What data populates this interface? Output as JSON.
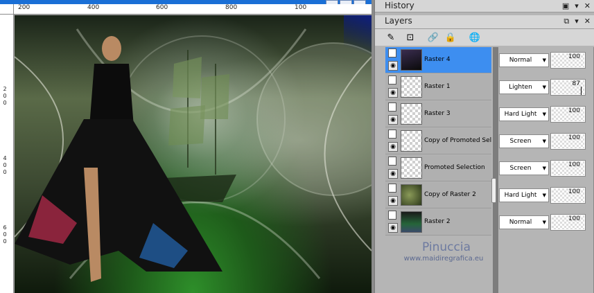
{
  "rulers": {
    "horizontal": [
      "200",
      "400",
      "600",
      "800",
      "100"
    ],
    "vertical": [
      [
        "2",
        "0",
        "0"
      ],
      [
        "4",
        "0",
        "0"
      ],
      [
        "6",
        "0",
        "0"
      ]
    ]
  },
  "panels": {
    "history": {
      "title": "History"
    },
    "layers": {
      "title": "Layers"
    }
  },
  "icons": {
    "history_controls": [
      "▣",
      "▾",
      "✕"
    ],
    "layers_controls": [
      "⧉",
      "▾",
      "✕"
    ],
    "toolbar": [
      "✎",
      "⊡",
      "🔗",
      "🔒",
      "🌐"
    ]
  },
  "layers": [
    {
      "name": "Raster 4",
      "blend": "Normal",
      "opacity": "100",
      "selected": true,
      "thumb": "dark"
    },
    {
      "name": "Raster 1",
      "blend": "Lighten",
      "opacity": "87",
      "selected": false,
      "thumb": "checker"
    },
    {
      "name": "Raster 3",
      "blend": "Hard Light",
      "opacity": "100",
      "selected": false,
      "thumb": "checker"
    },
    {
      "name": "Copy of Promoted Sele",
      "blend": "Screen",
      "opacity": "100",
      "selected": false,
      "thumb": "checker"
    },
    {
      "name": "Promoted Selection",
      "blend": "Screen",
      "opacity": "100",
      "selected": false,
      "thumb": "checker"
    },
    {
      "name": "Copy of Raster 2",
      "blend": "Hard Light",
      "opacity": "100",
      "selected": false,
      "thumb": "green"
    },
    {
      "name": "Raster 2",
      "blend": "Normal",
      "opacity": "100",
      "selected": false,
      "thumb": "greenish"
    }
  ],
  "watermark": {
    "name": "Pinuccia",
    "url": "www.maidiregrafica.eu"
  },
  "colors": {
    "selection": "#3d8ef0",
    "titlebar_blue": "#1a6fd6"
  }
}
